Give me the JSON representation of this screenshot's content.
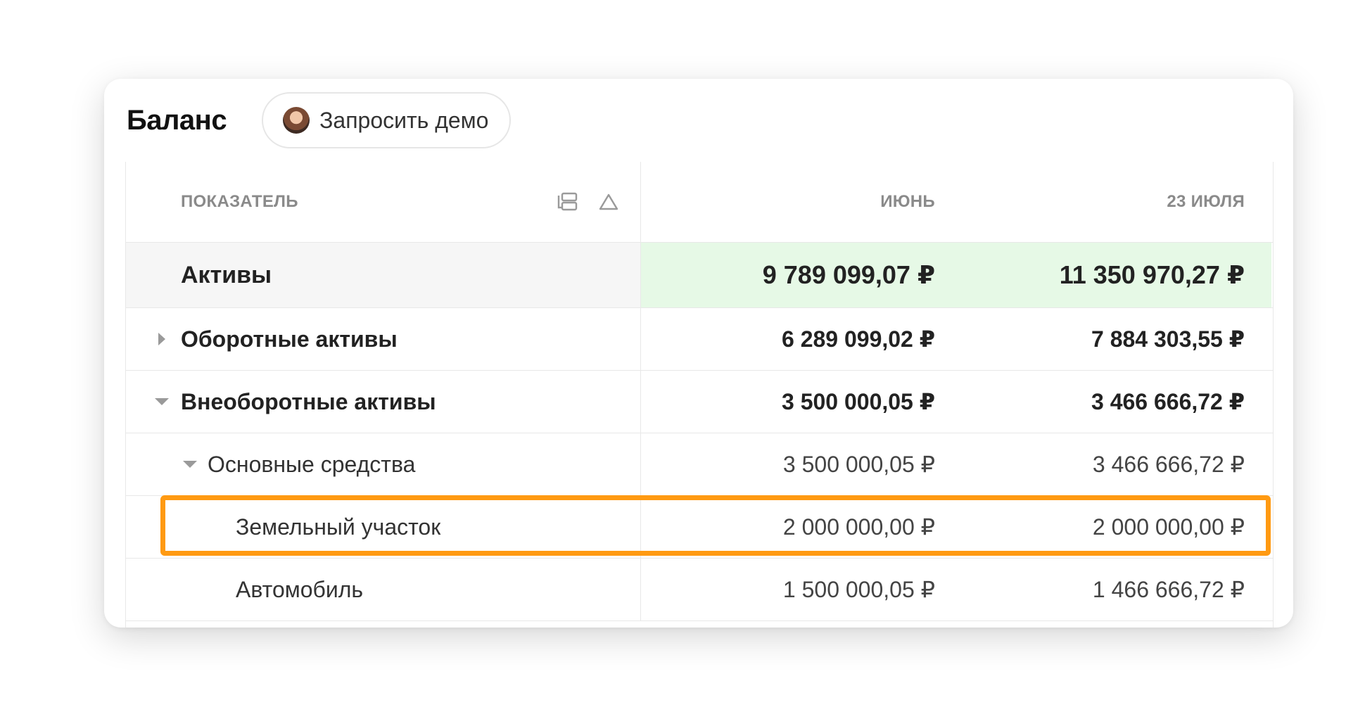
{
  "header": {
    "title": "Баланс",
    "demo_button": "Запросить демо"
  },
  "table": {
    "columns": {
      "indicator": "ПОКАЗАТЕЛЬ",
      "col1": "ИЮНЬ",
      "col2": "23 ИЮЛЯ"
    },
    "total": {
      "label": "Активы",
      "col1": "9 789 099,07 ₽",
      "col2": "11 350 970,27 ₽"
    },
    "rows": [
      {
        "label": "Оборотные активы",
        "col1": "6 289 099,02 ₽",
        "col2": "7 884 303,55 ₽",
        "expanded": false
      },
      {
        "label": "Внеоборотные активы",
        "col1": "3 500 000,05 ₽",
        "col2": "3 466 666,72 ₽",
        "expanded": true
      },
      {
        "label": "Основные средства",
        "col1": "3 500 000,05 ₽",
        "col2": "3 466 666,72 ₽",
        "expanded": true
      },
      {
        "label": "Земельный участок",
        "col1": "2 000 000,00 ₽",
        "col2": "2 000 000,00 ₽",
        "highlighted": true
      },
      {
        "label": "Автомобиль",
        "col1": "1 500 000,05 ₽",
        "col2": "1 466 666,72 ₽"
      }
    ]
  },
  "colors": {
    "highlight": "#ff9a12",
    "total_value_bg": "#e6f9e6"
  }
}
